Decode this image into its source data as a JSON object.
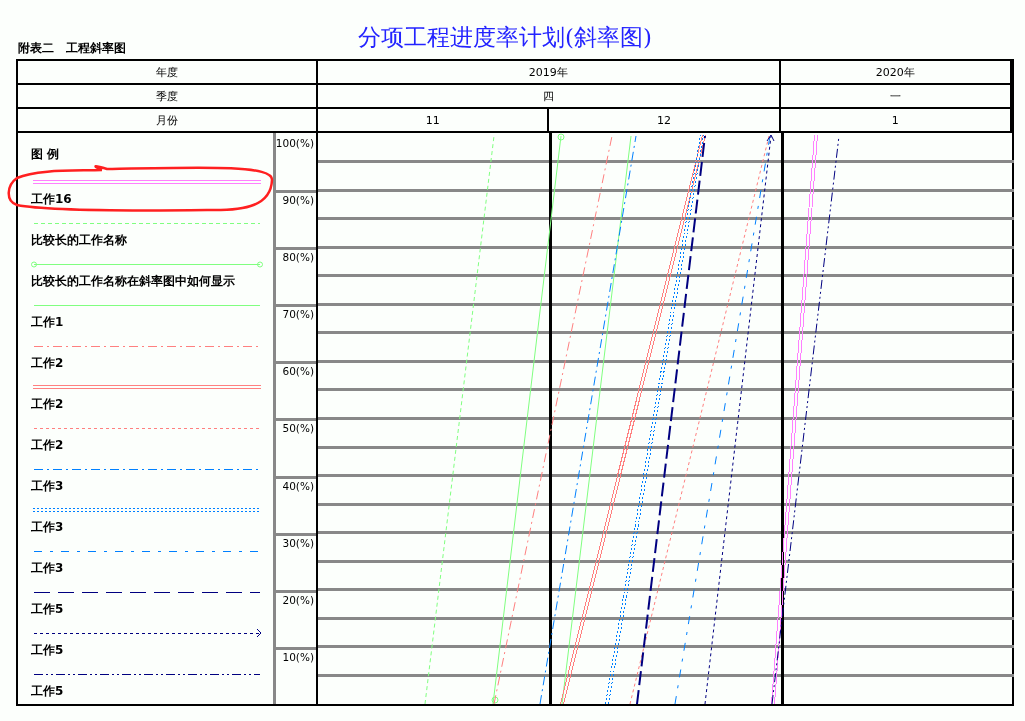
{
  "title": "分项工程进度率计划(斜率图)",
  "subtitle": "附表二　工程斜率图",
  "header": {
    "year_label": "年度",
    "quarter_label": "季度",
    "month_label": "月份"
  },
  "years": [
    {
      "label": "2019年",
      "quarters": [
        {
          "label": "四",
          "months": [
            "11",
            "12"
          ]
        }
      ]
    },
    {
      "label": "2020年",
      "quarters": [
        {
          "label": "一",
          "months": [
            "1"
          ]
        }
      ]
    }
  ],
  "legend": {
    "title": "图 例",
    "items": [
      {
        "name": "工作16",
        "kind": "double",
        "color": "#ff80ff",
        "highlighted": true
      },
      {
        "name": "比较长的工作名称",
        "kind": "dashed",
        "color": "#80ff80",
        "highlighted": false
      },
      {
        "name": "比较长的工作名称在斜率图中如何显示",
        "kind": "solid-circles",
        "color": "#80ff80",
        "highlighted": false
      },
      {
        "name": "工作1",
        "kind": "solid",
        "color": "#80ff80",
        "highlighted": false
      },
      {
        "name": "工作2",
        "kind": "dash-dot",
        "color": "#ff8080",
        "highlighted": false
      },
      {
        "name": "工作2",
        "kind": "double",
        "color": "#ff8080",
        "highlighted": false
      },
      {
        "name": "工作2",
        "kind": "dotted",
        "color": "#ff8080",
        "highlighted": false
      },
      {
        "name": "工作3",
        "kind": "dash-dot",
        "color": "#0080ff",
        "highlighted": false
      },
      {
        "name": "工作3",
        "kind": "double-dotted",
        "color": "#0080ff",
        "highlighted": false
      },
      {
        "name": "工作3",
        "kind": "dash-gap",
        "color": "#0080ff",
        "highlighted": false
      },
      {
        "name": "工作5",
        "kind": "long-dash",
        "color": "#000080",
        "highlighted": false
      },
      {
        "name": "工作5",
        "kind": "dotted-arrow",
        "color": "#000080",
        "highlighted": false
      },
      {
        "name": "工作5",
        "kind": "dash-dot-dot",
        "color": "#000080",
        "highlighted": false
      }
    ]
  },
  "y_axis_labels": [
    "100(%)",
    "90(%)",
    "80(%)",
    "70(%)",
    "60(%)",
    "50(%)",
    "40(%)",
    "30(%)",
    "20(%)",
    "10(%)"
  ]
}
